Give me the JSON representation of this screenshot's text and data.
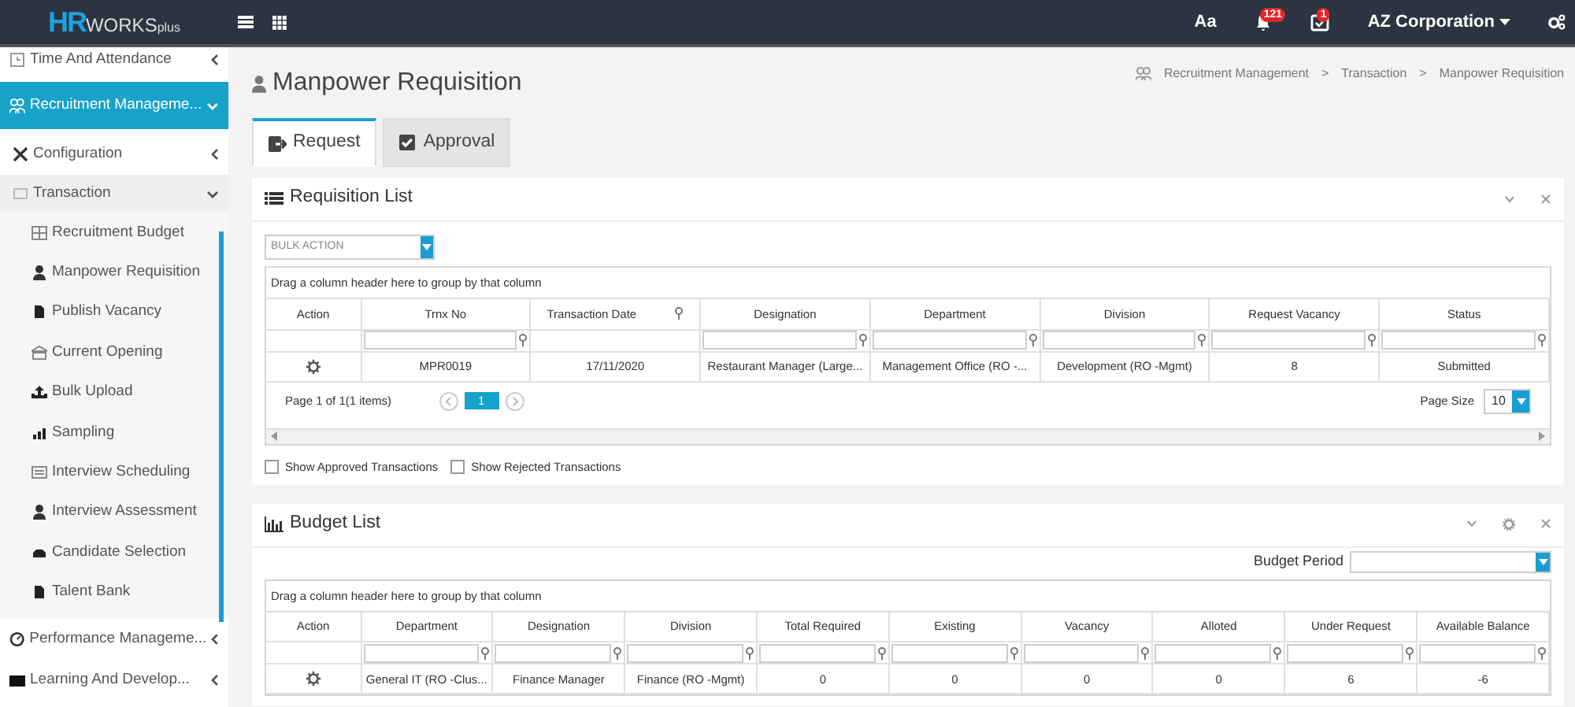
{
  "brand": {
    "bold": "HR",
    "rest": "WORKS",
    "suffix": "plus"
  },
  "topbar": {
    "font_button": "Aa",
    "notifications": "121",
    "tasks": "1",
    "company": "AZ Corporation"
  },
  "sidebar": {
    "items": [
      {
        "label": "Time And Attendance",
        "expanded": false,
        "selected": false
      },
      {
        "label": "Recruitment Manageme...",
        "expanded": true,
        "selected": true,
        "children": [
          {
            "label": "Configuration",
            "expanded": false,
            "selected": false
          },
          {
            "label": "Transaction",
            "expanded": true,
            "selected": false,
            "children": [
              {
                "label": "Recruitment Budget"
              },
              {
                "label": "Manpower Requisition"
              },
              {
                "label": "Publish Vacancy"
              },
              {
                "label": "Current Opening"
              },
              {
                "label": "Bulk Upload"
              },
              {
                "label": "Sampling"
              },
              {
                "label": "Interview Scheduling"
              },
              {
                "label": "Interview Assessment"
              },
              {
                "label": "Candidate Selection"
              },
              {
                "label": "Talent Bank"
              }
            ]
          }
        ]
      },
      {
        "label": "Performance Manageme...",
        "expanded": false,
        "selected": false
      },
      {
        "label": "Learning And Develop...",
        "expanded": false,
        "selected": false
      }
    ]
  },
  "page": {
    "title": "Manpower Requisition",
    "breadcrumb": [
      {
        "label": "Recruitment Management"
      },
      {
        "separator": ">",
        "label": "Transaction"
      },
      {
        "separator": ">",
        "label": "Manpower Requisition"
      }
    ]
  },
  "tabs": [
    {
      "label": "Request",
      "selected": true
    },
    {
      "label": "Approval",
      "selected": false
    }
  ],
  "requisition": {
    "title": "Requisition List",
    "bulk_action": {
      "placeholder": "BULK ACTION"
    },
    "group_hint": "Drag a column header here to group by that column",
    "columns": [
      {
        "label": "Action",
        "kind": "action"
      },
      {
        "label": "Trnx No",
        "kind": "filter"
      },
      {
        "label": "Transaction Date",
        "kind": "header_filter"
      },
      {
        "label": "Designation",
        "kind": "filter"
      },
      {
        "label": "Department",
        "kind": "filter"
      },
      {
        "label": "Division",
        "kind": "filter"
      },
      {
        "label": "Request Vacancy",
        "kind": "filter"
      },
      {
        "label": "Status",
        "kind": "filter"
      }
    ],
    "rows": [
      [
        "",
        "MPR0019",
        "17/11/2020",
        "Restaurant Manager (Large...",
        "Management Office (RO -...",
        "Development (RO -Mgmt)",
        "8",
        "Submitted"
      ]
    ],
    "pager": {
      "summary": "Page 1 of 1(1 items)",
      "pages": [
        {
          "label": "1",
          "selected": true
        }
      ],
      "size_label": "Page Size",
      "size": "10"
    },
    "checkboxes": [
      {
        "label": "Show Approved Transactions",
        "checked": false
      },
      {
        "label": "Show Rejected Transactions",
        "checked": false
      }
    ]
  },
  "budget": {
    "title": "Budget List",
    "period_label": "Budget Period",
    "group_hint": "Drag a column header here to group by that column",
    "columns": [
      {
        "label": "Action",
        "kind": "action"
      },
      {
        "label": "Department",
        "kind": "filter"
      },
      {
        "label": "Designation",
        "kind": "filter"
      },
      {
        "label": "Division",
        "kind": "filter"
      },
      {
        "label": "Total Required",
        "kind": "filter"
      },
      {
        "label": "Existing",
        "kind": "filter"
      },
      {
        "label": "Vacancy",
        "kind": "filter"
      },
      {
        "label": "Alloted",
        "kind": "filter"
      },
      {
        "label": "Under Request",
        "kind": "filter"
      },
      {
        "label": "Available Balance",
        "kind": "filter"
      }
    ],
    "rows": [
      [
        "",
        "General IT (RO -Clus...",
        "Finance Manager",
        "Finance (RO -Mgmt)",
        "0",
        "0",
        "0",
        "0",
        "6",
        "-6"
      ]
    ]
  }
}
